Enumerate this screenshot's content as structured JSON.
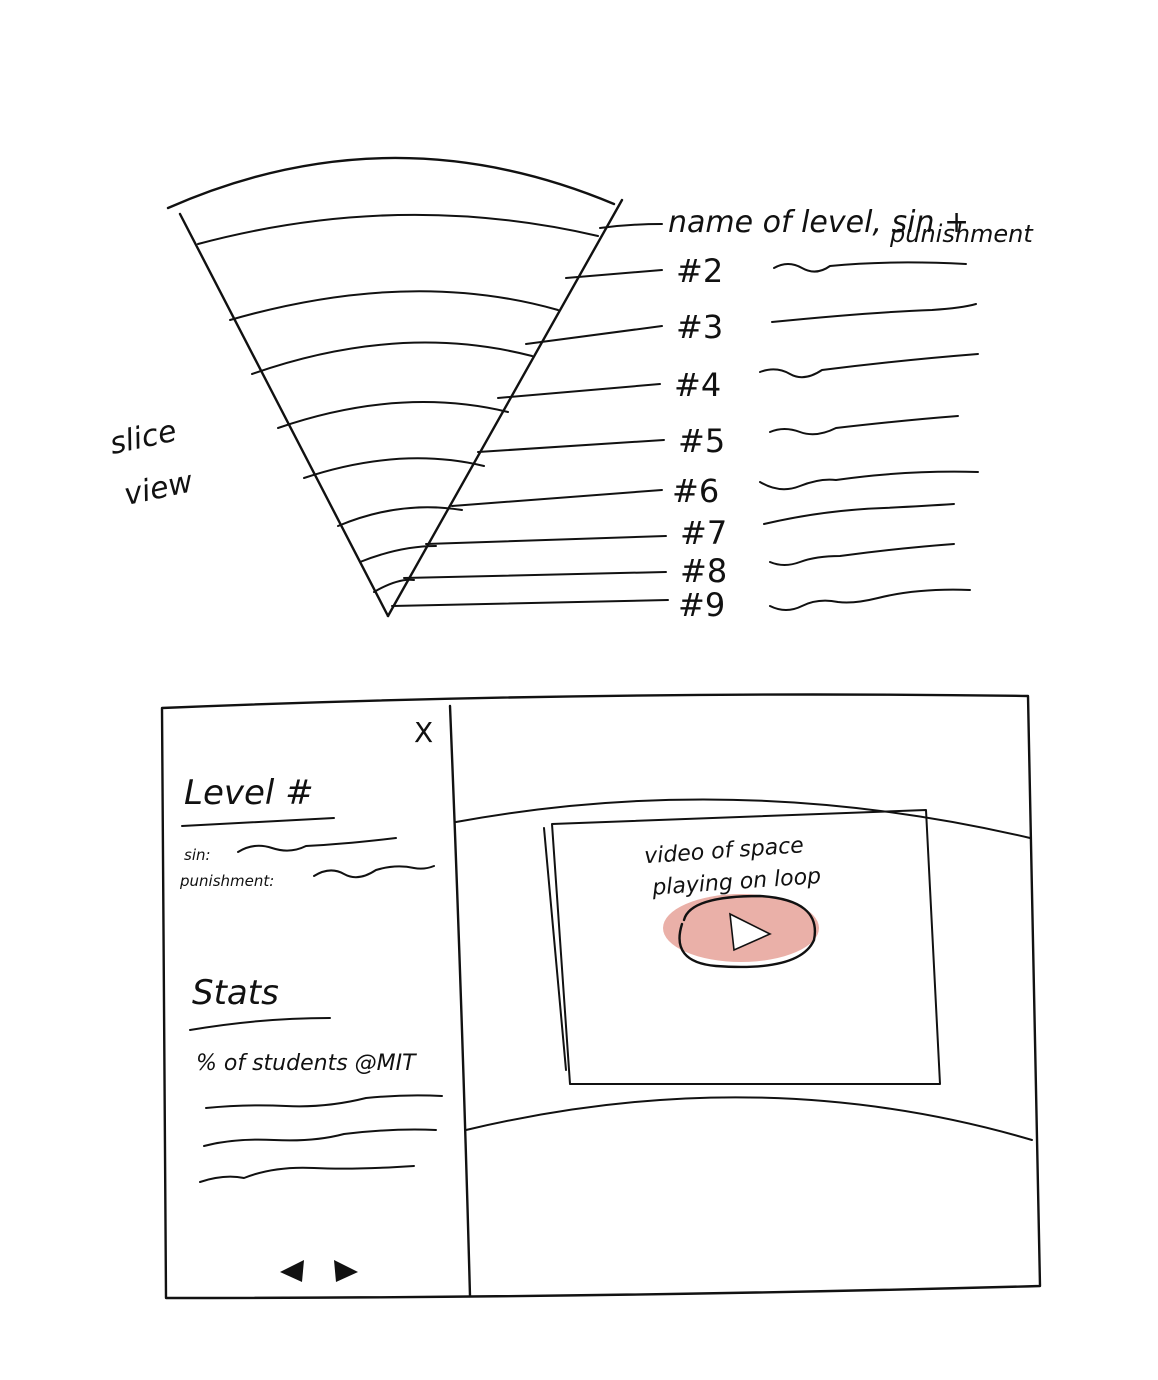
{
  "slice_view_label": [
    "slice",
    "view"
  ],
  "level_caption": [
    "name of level, sin +",
    "punishment"
  ],
  "levels": [
    "#2",
    "#3",
    "#4",
    "#5",
    "#6",
    "#7",
    "#8",
    "#9"
  ],
  "panel": {
    "close_label": "X",
    "level_title": "Level #",
    "sin_label": "sin:",
    "punishment_label": "punishment:",
    "stats_title": "Stats",
    "stats_subtitle": "% of students @MIT"
  },
  "video": {
    "caption": [
      "video of space",
      "playing on loop"
    ],
    "play_color": "#eab0a8"
  },
  "nav": {
    "prev_icon": "triangle-left-icon",
    "next_icon": "triangle-right-icon"
  }
}
